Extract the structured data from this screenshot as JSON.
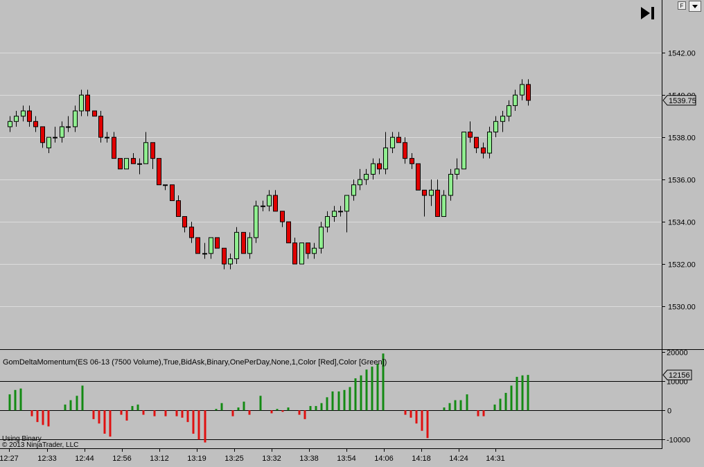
{
  "toolbar": {
    "f_label": "F"
  },
  "indicator": {
    "title": "GomDeltaMomentum(ES 06-13 (7500 Volume),True,BidAsk,Binary,OnePerDay,None,1,Color [Red],Color [Green])",
    "mode_text": "Using Binary"
  },
  "copyright": "© 2013 NinjaTrader, LLC",
  "colors": {
    "up": "#90ee90",
    "down": "#e00000",
    "hist_up": "#138a13",
    "hist_down": "#e01010"
  },
  "chart_data": [
    {
      "type": "candlestick",
      "y_ticks": [
        "1542.00",
        "1540.00",
        "1538.00",
        "1536.00",
        "1534.00",
        "1532.00",
        "1530.00"
      ],
      "ylim": [
        1528.0,
        1544.5
      ],
      "last_price": "1539.75",
      "x_labels": [
        "12:27",
        "12:33",
        "12:44",
        "12:56",
        "13:12",
        "13:19",
        "13:25",
        "13:32",
        "13:38",
        "13:54",
        "14:06",
        "14:18",
        "14:24",
        "14:31"
      ],
      "ohlc": [
        [
          1538.5,
          1539.0,
          1538.25,
          1538.75
        ],
        [
          1538.75,
          1539.25,
          1538.5,
          1539.0
        ],
        [
          1539.0,
          1539.5,
          1538.75,
          1539.25
        ],
        [
          1539.25,
          1539.5,
          1538.5,
          1538.75
        ],
        [
          1538.75,
          1539.0,
          1538.25,
          1538.5
        ],
        [
          1538.5,
          1538.5,
          1537.5,
          1537.75
        ],
        [
          1537.5,
          1538.0,
          1537.25,
          1538.0
        ],
        [
          1538.0,
          1538.5,
          1537.75,
          1538.0
        ],
        [
          1538.0,
          1538.75,
          1537.75,
          1538.5
        ],
        [
          1538.5,
          1539.0,
          1538.25,
          1538.5
        ],
        [
          1538.5,
          1539.5,
          1538.25,
          1539.25
        ],
        [
          1539.25,
          1540.25,
          1539.0,
          1540.0
        ],
        [
          1540.0,
          1540.25,
          1539.0,
          1539.25
        ],
        [
          1539.25,
          1539.25,
          1539.0,
          1539.0
        ],
        [
          1539.0,
          1539.25,
          1537.75,
          1538.0
        ],
        [
          1538.0,
          1538.25,
          1537.75,
          1538.0
        ],
        [
          1538.0,
          1538.25,
          1537.0,
          1537.0
        ],
        [
          1537.0,
          1537.0,
          1536.5,
          1536.5
        ],
        [
          1536.5,
          1537.0,
          1536.5,
          1537.0
        ],
        [
          1537.0,
          1537.25,
          1536.75,
          1536.75
        ],
        [
          1536.75,
          1537.0,
          1536.25,
          1536.75
        ],
        [
          1536.75,
          1538.25,
          1536.75,
          1537.75
        ],
        [
          1537.75,
          1537.75,
          1536.5,
          1537.0
        ],
        [
          1537.0,
          1537.0,
          1535.75,
          1535.75
        ],
        [
          1535.75,
          1535.75,
          1535.5,
          1535.75
        ],
        [
          1535.75,
          1535.75,
          1535.0,
          1535.0
        ],
        [
          1535.0,
          1535.25,
          1534.25,
          1534.25
        ],
        [
          1534.25,
          1534.25,
          1533.5,
          1533.75
        ],
        [
          1533.75,
          1534.0,
          1533.0,
          1533.25
        ],
        [
          1533.25,
          1533.25,
          1532.5,
          1532.5
        ],
        [
          1532.5,
          1533.0,
          1532.25,
          1532.5
        ],
        [
          1532.5,
          1533.25,
          1532.25,
          1533.25
        ],
        [
          1533.25,
          1533.25,
          1532.75,
          1532.75
        ],
        [
          1532.75,
          1532.75,
          1531.75,
          1532.0
        ],
        [
          1532.0,
          1532.5,
          1531.75,
          1532.25
        ],
        [
          1532.25,
          1533.75,
          1532.0,
          1533.5
        ],
        [
          1533.5,
          1533.5,
          1532.5,
          1532.5
        ],
        [
          1532.5,
          1533.5,
          1532.25,
          1533.25
        ],
        [
          1533.25,
          1535.0,
          1533.0,
          1534.75
        ],
        [
          1534.75,
          1535.0,
          1534.5,
          1534.75
        ],
        [
          1534.75,
          1535.5,
          1534.5,
          1535.25
        ],
        [
          1535.25,
          1535.5,
          1534.5,
          1534.5
        ],
        [
          1534.5,
          1534.5,
          1533.75,
          1534.0
        ],
        [
          1534.0,
          1534.0,
          1533.0,
          1533.0
        ],
        [
          1533.0,
          1533.25,
          1532.0,
          1532.0
        ],
        [
          1532.0,
          1533.0,
          1532.0,
          1533.0
        ],
        [
          1533.0,
          1533.0,
          1532.25,
          1532.5
        ],
        [
          1532.5,
          1533.0,
          1532.25,
          1532.75
        ],
        [
          1532.75,
          1534.0,
          1532.5,
          1533.75
        ],
        [
          1533.75,
          1534.5,
          1533.5,
          1534.25
        ],
        [
          1534.25,
          1534.75,
          1534.0,
          1534.5
        ],
        [
          1534.5,
          1534.75,
          1534.25,
          1534.5
        ],
        [
          1534.5,
          1534.75,
          1533.5,
          1535.25
        ],
        [
          1535.25,
          1536.0,
          1535.0,
          1535.75
        ],
        [
          1535.75,
          1536.5,
          1535.5,
          1536.0
        ],
        [
          1536.0,
          1536.5,
          1535.75,
          1536.25
        ],
        [
          1536.25,
          1537.0,
          1536.0,
          1536.75
        ],
        [
          1536.75,
          1537.0,
          1536.25,
          1536.5
        ],
        [
          1536.5,
          1538.25,
          1536.25,
          1537.5
        ],
        [
          1537.5,
          1538.25,
          1537.25,
          1538.0
        ],
        [
          1538.0,
          1538.25,
          1537.75,
          1537.75
        ],
        [
          1537.75,
          1538.0,
          1536.75,
          1537.0
        ],
        [
          1537.0,
          1537.25,
          1536.5,
          1536.75
        ],
        [
          1536.75,
          1536.75,
          1535.5,
          1535.5
        ],
        [
          1535.5,
          1535.5,
          1534.25,
          1535.25
        ],
        [
          1535.25,
          1536.0,
          1534.75,
          1535.5
        ],
        [
          1535.5,
          1536.0,
          1534.25,
          1534.25
        ],
        [
          1534.25,
          1535.5,
          1534.25,
          1535.25
        ],
        [
          1535.25,
          1536.5,
          1535.0,
          1536.25
        ],
        [
          1536.25,
          1537.0,
          1536.0,
          1536.5
        ],
        [
          1536.5,
          1538.25,
          1536.5,
          1538.25
        ],
        [
          1538.25,
          1538.75,
          1537.75,
          1538.0
        ],
        [
          1538.0,
          1538.0,
          1537.25,
          1537.5
        ],
        [
          1537.5,
          1537.75,
          1537.0,
          1537.25
        ],
        [
          1537.25,
          1538.5,
          1537.0,
          1538.25
        ],
        [
          1538.25,
          1539.0,
          1538.0,
          1538.75
        ],
        [
          1538.75,
          1539.25,
          1538.25,
          1539.0
        ],
        [
          1539.0,
          1539.75,
          1538.75,
          1539.5
        ],
        [
          1539.5,
          1540.25,
          1539.25,
          1540.0
        ],
        [
          1540.0,
          1540.75,
          1539.75,
          1540.5
        ],
        [
          1540.5,
          1540.75,
          1539.5,
          1539.75
        ]
      ]
    },
    {
      "type": "bar",
      "title": "GomDeltaMomentum(ES 06-13 (7500 Volume),True,BidAsk,Binary,OnePerDay,None,1,Color [Red],Color [Green])",
      "y_ticks": [
        "20000",
        "10000",
        "0",
        "-10000"
      ],
      "ylim": [
        -13000,
        20500
      ],
      "last_value": "12156",
      "values": [
        5500,
        7000,
        7500,
        0,
        -2000,
        -4000,
        -5000,
        -5500,
        0,
        0,
        2000,
        3500,
        5000,
        8500,
        0,
        -3000,
        -4500,
        -8000,
        -9000,
        0,
        -1500,
        -3500,
        1500,
        2000,
        -1500,
        0,
        -2000,
        0,
        -2000,
        0,
        -2000,
        -2500,
        -4000,
        -8000,
        -10000,
        -11000,
        0,
        500,
        2500,
        0,
        -2000,
        1000,
        3000,
        -1500,
        0,
        5000,
        0,
        -1000,
        500,
        -500,
        1000,
        0,
        -1500,
        -3000,
        1500,
        1500,
        2500,
        4500,
        6500,
        6500,
        7000,
        8000,
        11000,
        12000,
        14000,
        15000,
        16000,
        19500,
        0,
        0,
        0,
        -1500,
        -2500,
        -4500,
        -7000,
        -9500,
        0,
        0,
        1000,
        2500,
        3500,
        3500,
        5500,
        0,
        -2000,
        -2000,
        0,
        2000,
        4000,
        6000,
        8500,
        11500,
        12000,
        12156
      ]
    }
  ]
}
